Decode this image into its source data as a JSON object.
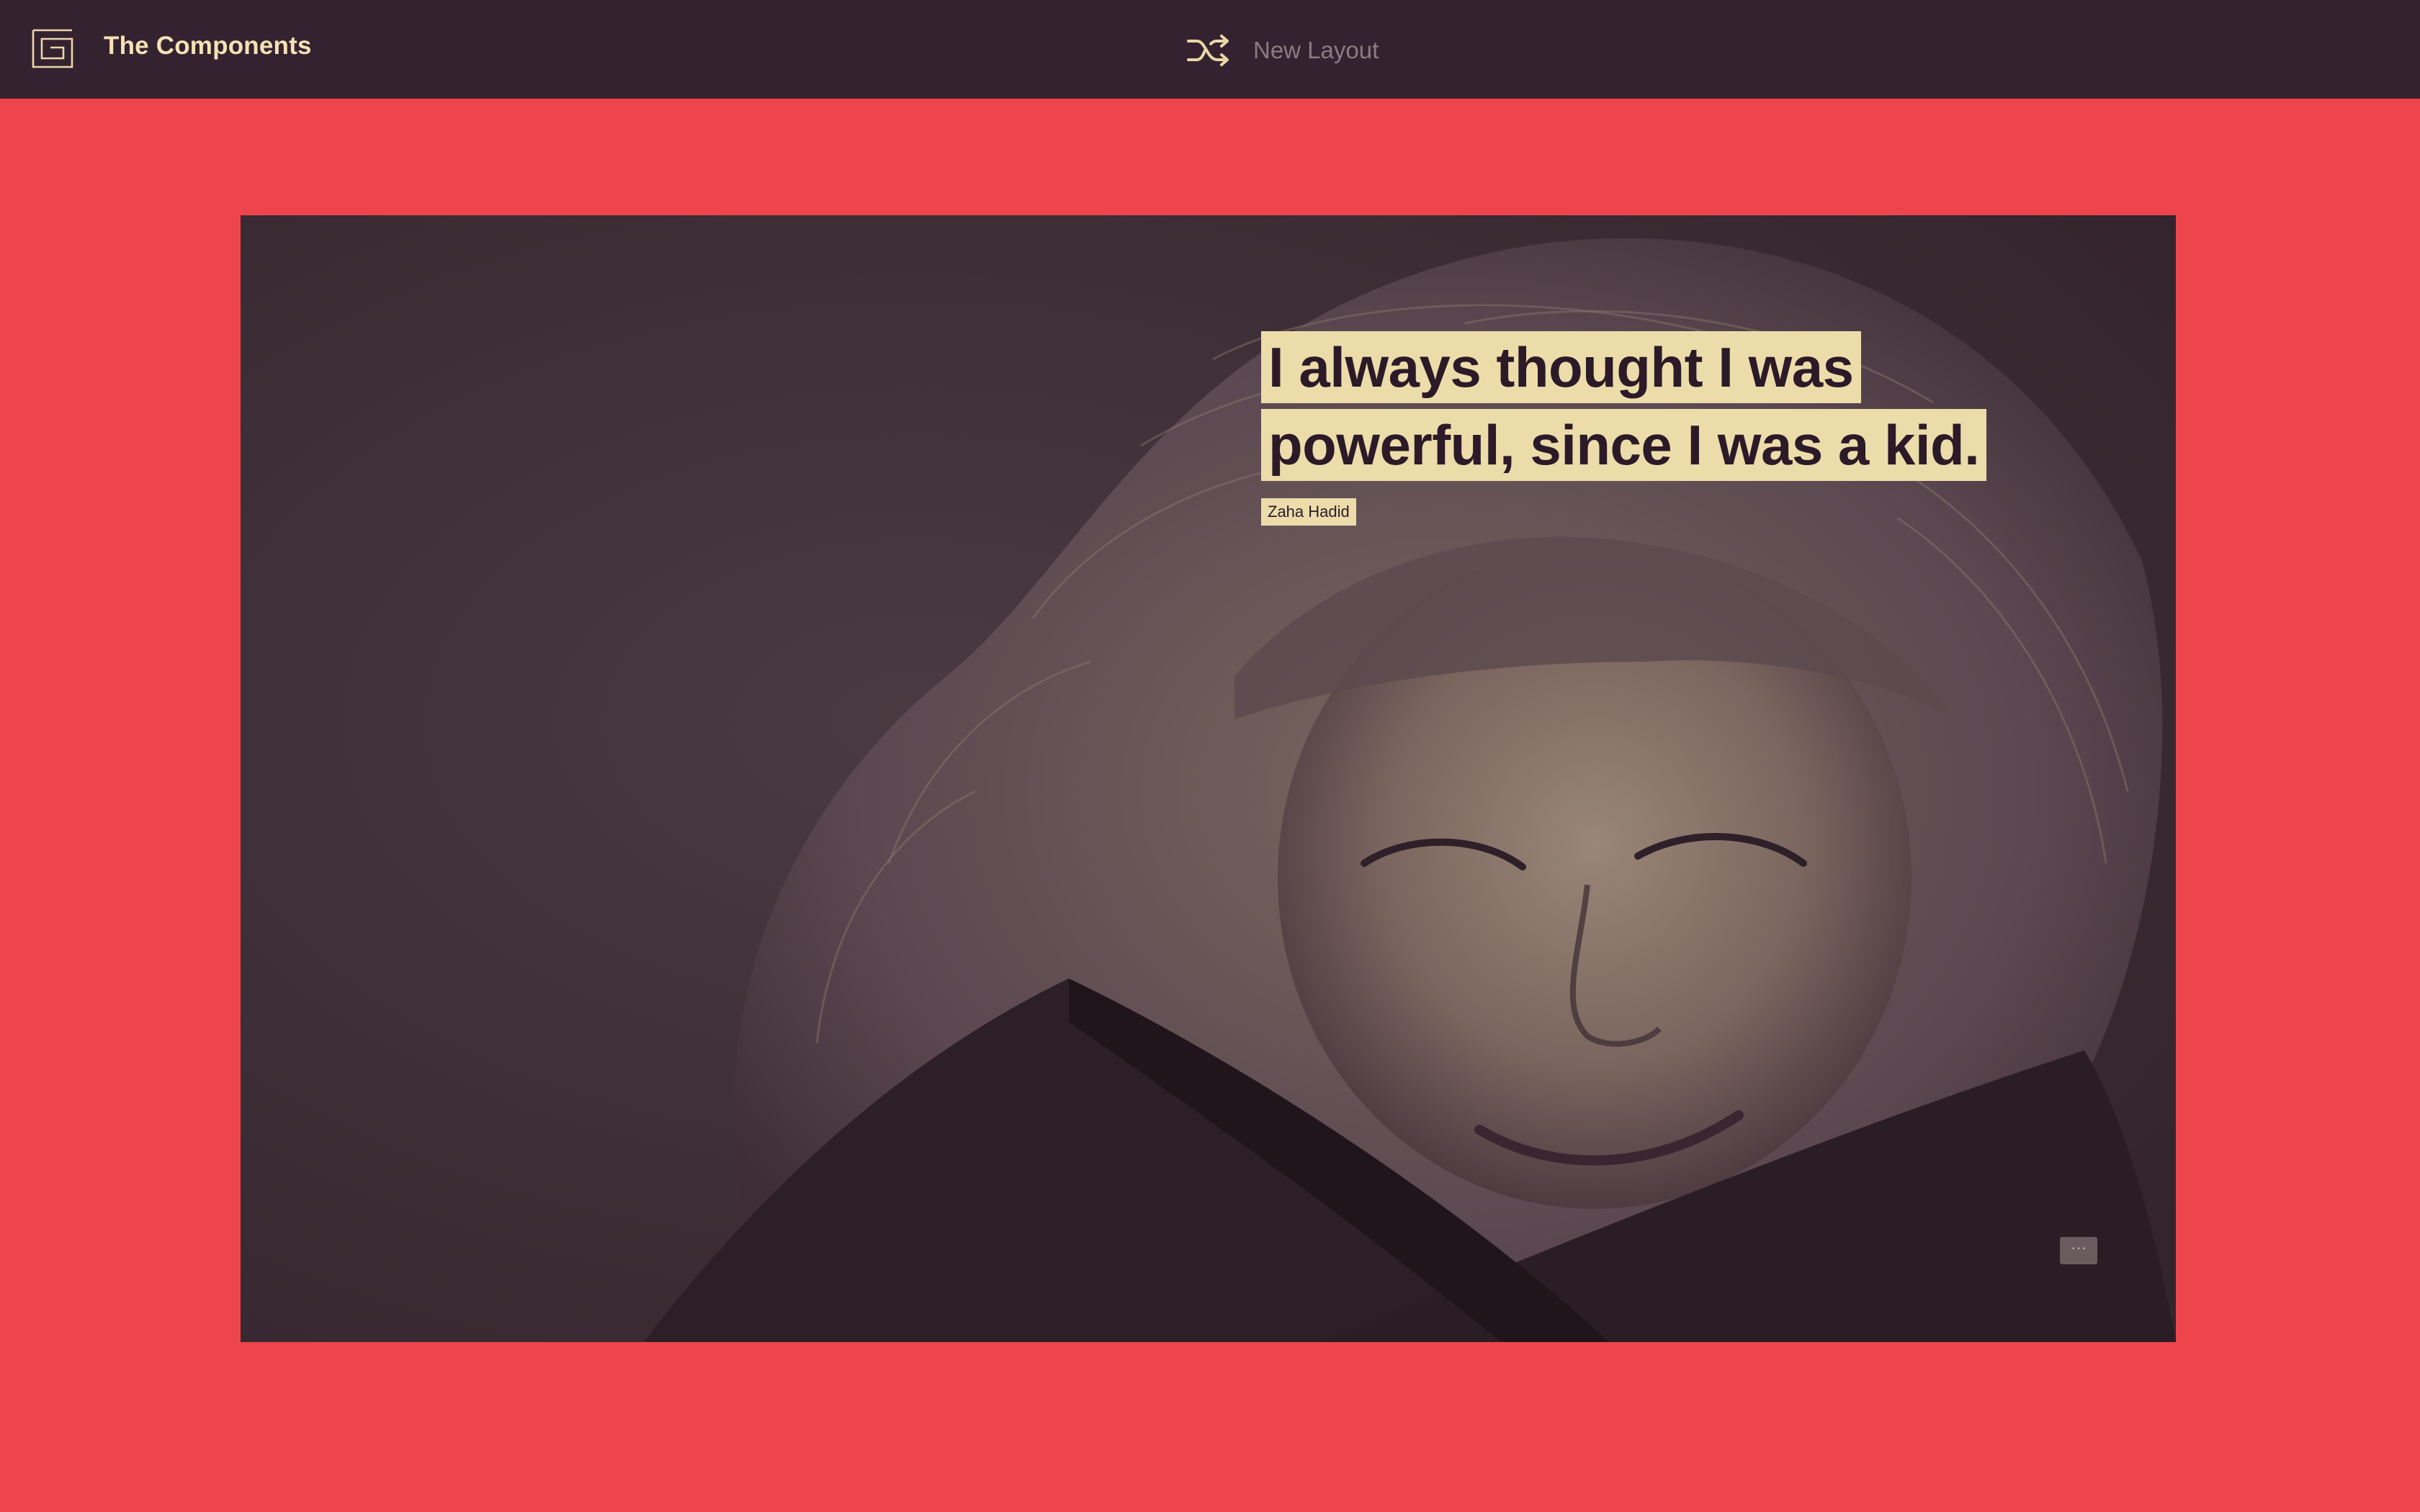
{
  "header": {
    "brand_title": "The Components",
    "new_layout_label": "New Layout",
    "logo_icon": "grid-logo-icon",
    "shuffle_icon": "shuffle-icon"
  },
  "hero": {
    "quote_lines": [
      "I always thought I was",
      "powerful, since I was a kid."
    ],
    "author": "Zaha Hadid",
    "more_label": "···"
  },
  "colors": {
    "page_background": "#ee444b",
    "topbar": "#352230",
    "accent_cream": "#ecdcaa",
    "text_dark": "#2c1a28"
  }
}
